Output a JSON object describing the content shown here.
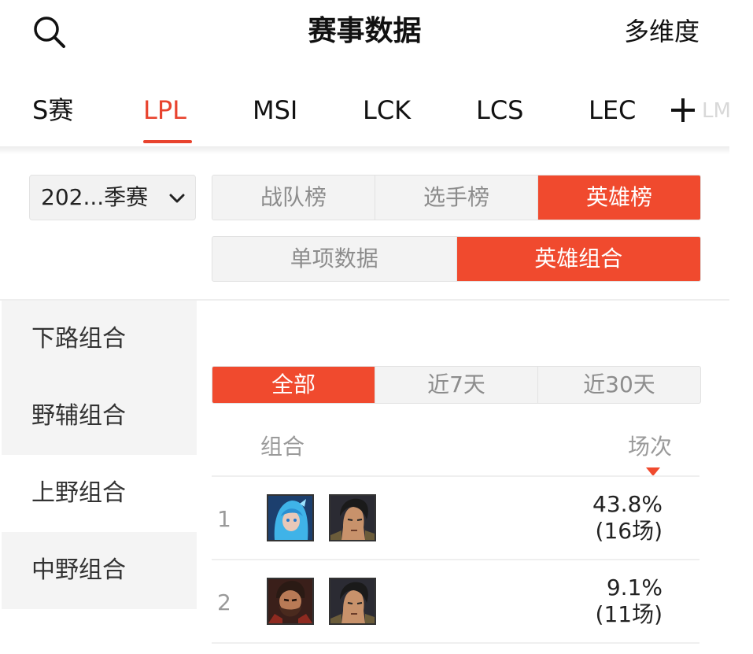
{
  "header": {
    "title": "赛事数据",
    "right_label": "多维度",
    "search_icon": "search-icon"
  },
  "league_tabs": {
    "items": [
      "S赛",
      "LPL",
      "MSI",
      "LCK",
      "LCS",
      "LEC"
    ],
    "active_index": 1,
    "add_icon": "plus-icon",
    "ghost_label": "LM"
  },
  "season": {
    "value": "202...季赛",
    "icon": "chevron-down-icon"
  },
  "rank_tabs": {
    "items": [
      "战队榜",
      "选手榜",
      "英雄榜"
    ],
    "active_index": 2
  },
  "data_tabs": {
    "items": [
      "单项数据",
      "英雄组合"
    ],
    "active_index": 1
  },
  "categories": {
    "items": [
      "下路组合",
      "野辅组合",
      "上野组合",
      "中野组合"
    ],
    "selected_index": 2
  },
  "time_tabs": {
    "items": [
      "全部",
      "近7天",
      "近30天"
    ],
    "active_index": 0
  },
  "table": {
    "col_combo": "组合",
    "col_games": "场次",
    "sort_icon": "sort-down-icon",
    "rows": [
      {
        "rank": "1",
        "rate": "43.8%",
        "games": "(16场)",
        "heroes": [
          "blue-haired-hero-portrait",
          "dark-haired-hero-portrait"
        ]
      },
      {
        "rank": "2",
        "rate": "9.1%",
        "games": "(11场)",
        "heroes": [
          "bearded-hero-portrait",
          "dark-haired-hero-portrait"
        ]
      }
    ]
  },
  "colors": {
    "accent": "#f04a2e",
    "tab_active": "#e8432e",
    "inactive_text": "#8c8c8c"
  }
}
